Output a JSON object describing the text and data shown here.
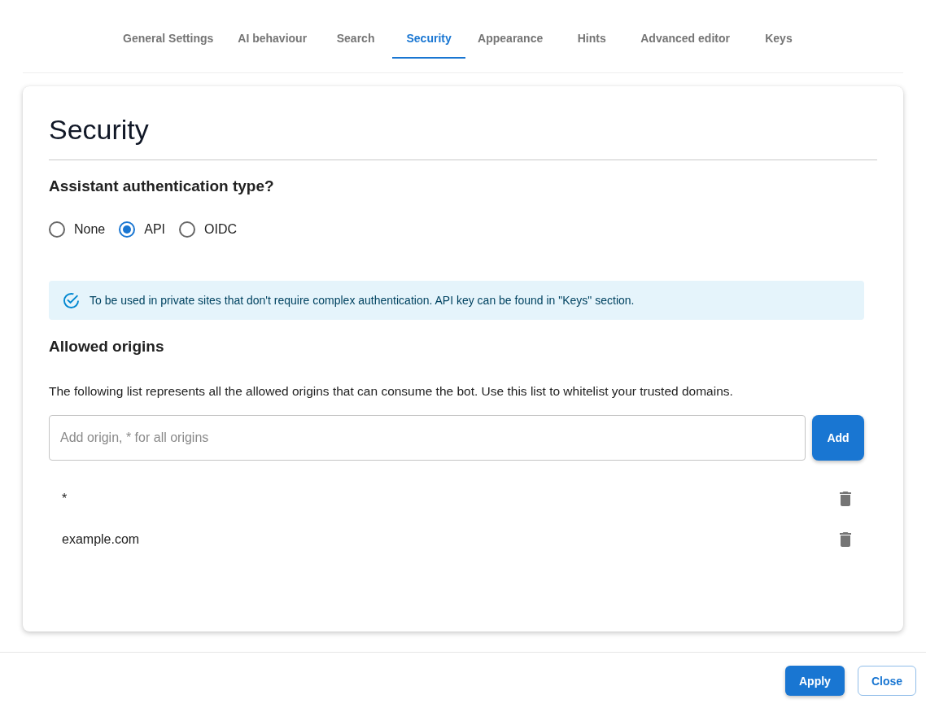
{
  "tabs": [
    {
      "label": "General Settings",
      "selected": false
    },
    {
      "label": "AI behaviour",
      "selected": false
    },
    {
      "label": "Search",
      "selected": false
    },
    {
      "label": "Security",
      "selected": true
    },
    {
      "label": "Appearance",
      "selected": false
    },
    {
      "label": "Hints",
      "selected": false
    },
    {
      "label": "Advanced editor",
      "selected": false
    },
    {
      "label": "Keys",
      "selected": false
    }
  ],
  "panel": {
    "title": "Security",
    "auth_question": "Assistant authentication type?",
    "auth_options": [
      {
        "label": "None",
        "selected": false
      },
      {
        "label": "API",
        "selected": true
      },
      {
        "label": "OIDC",
        "selected": false
      }
    ],
    "info_alert": "To be used in private sites that don't require complex authentication. API key can be found in \"Keys\" section.",
    "origins_heading": "Allowed origins",
    "origins_description": "The following list represents all the allowed origins that can consume the bot. Use this list to whitelist your trusted domains.",
    "origin_input": {
      "placeholder": "Add origin, * for all origins"
    },
    "add_button": "Add",
    "origins": [
      "*",
      "example.com"
    ]
  },
  "footer": {
    "buttons": [
      {
        "label": "Apply",
        "kind": "primary"
      },
      {
        "label": "Close",
        "kind": "outlined"
      }
    ]
  }
}
